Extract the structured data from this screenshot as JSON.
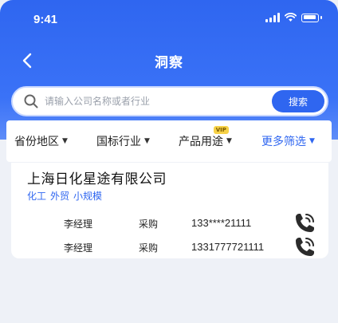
{
  "status": {
    "time": "9:41"
  },
  "nav": {
    "title": "洞察"
  },
  "search": {
    "placeholder": "请输入公司名称或者行业",
    "button_label": "搜索"
  },
  "filters": {
    "province": "省份地区",
    "industry": "国标行业",
    "product": "产品用途",
    "product_badge": "VIP",
    "more": "更多筛选"
  },
  "company": {
    "name": "上海日化星途有限公司",
    "tags": [
      "化工",
      "外贸",
      "小规模"
    ],
    "contacts": [
      {
        "name": "李经理",
        "role": "采购",
        "phone": "133****21111"
      },
      {
        "name": "李经理",
        "role": "采购",
        "phone": "1331777721111"
      }
    ]
  },
  "colors": {
    "brand": "#2f66f0",
    "background": "#eef1f7"
  }
}
